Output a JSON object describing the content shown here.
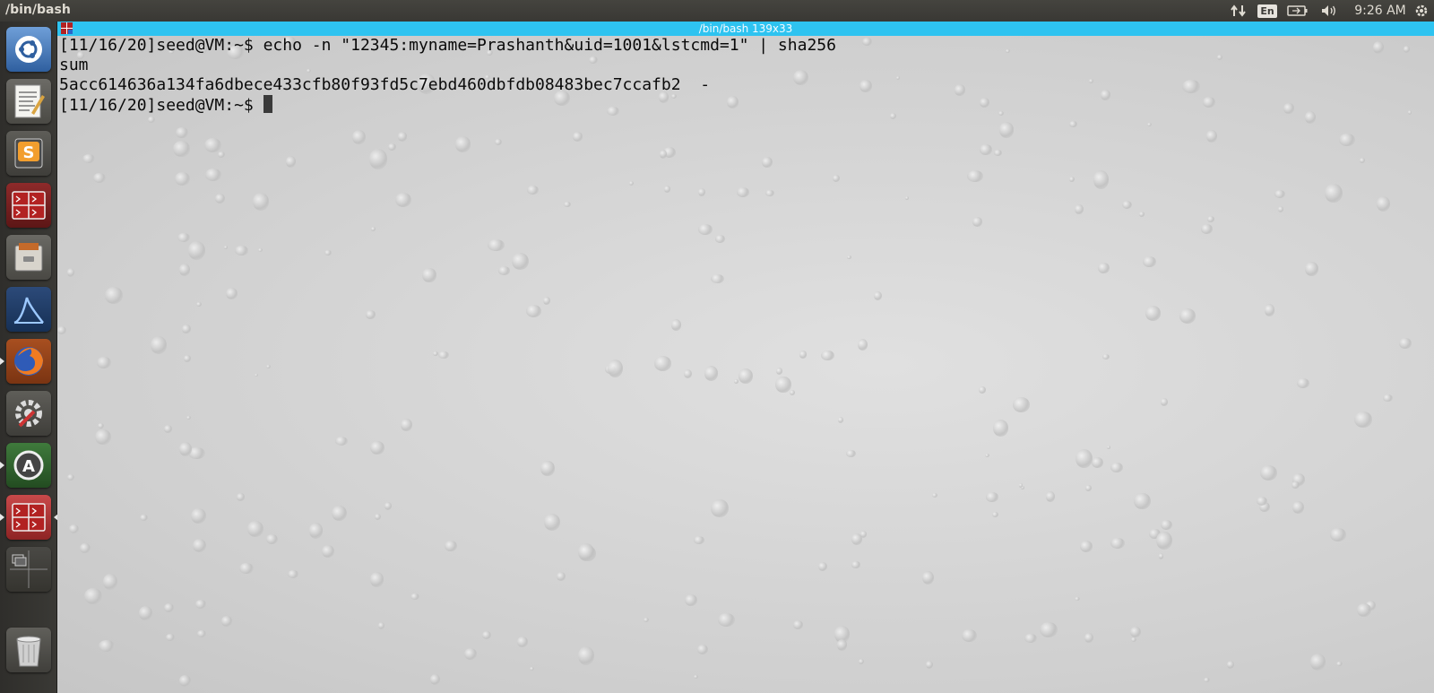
{
  "top_panel": {
    "app_title": "/bin/bash",
    "language": "En",
    "clock": "9:26 AM",
    "icons": [
      "network-icon",
      "keyboard-language-icon",
      "battery-icon",
      "volume-icon",
      "settings-gear-icon"
    ]
  },
  "launcher": {
    "items": [
      {
        "name": "ubuntu-dash",
        "icon": "ubuntu-logo-icon"
      },
      {
        "name": "text-editor",
        "icon": "text-editor-icon"
      },
      {
        "name": "sublime-text",
        "icon": "sublime-icon",
        "letter": "S"
      },
      {
        "name": "terminal",
        "icon": "terminal-icon"
      },
      {
        "name": "file-cabinet",
        "icon": "files-icon"
      },
      {
        "name": "wireshark",
        "icon": "wireshark-icon"
      },
      {
        "name": "firefox",
        "icon": "firefox-icon"
      },
      {
        "name": "system-settings",
        "icon": "settings-icon"
      },
      {
        "name": "software-updater",
        "icon": "software-updater-icon",
        "letter": "A"
      },
      {
        "name": "terminal-active",
        "icon": "terminal-icon"
      },
      {
        "name": "workspace-switcher",
        "icon": "workspace-icon"
      },
      {
        "name": "trash",
        "icon": "trash-icon"
      }
    ]
  },
  "terminal": {
    "window_title": "/bin/bash 139x33",
    "lines": [
      "[11/16/20]seed@VM:~$ echo -n \"12345:myname=Prashanth&uid=1001&lstcmd=1\" | sha256",
      "sum",
      "5acc614636a134fa6dbece433cfb80f93fd5c7ebd460dbfdb08483bec7ccafb2  -",
      "[11/16/20]seed@VM:~$ "
    ]
  },
  "colors": {
    "titlebar": "#2ec3f0",
    "panel": "#3c3b37",
    "terminal_text": "#0a0a0a"
  }
}
